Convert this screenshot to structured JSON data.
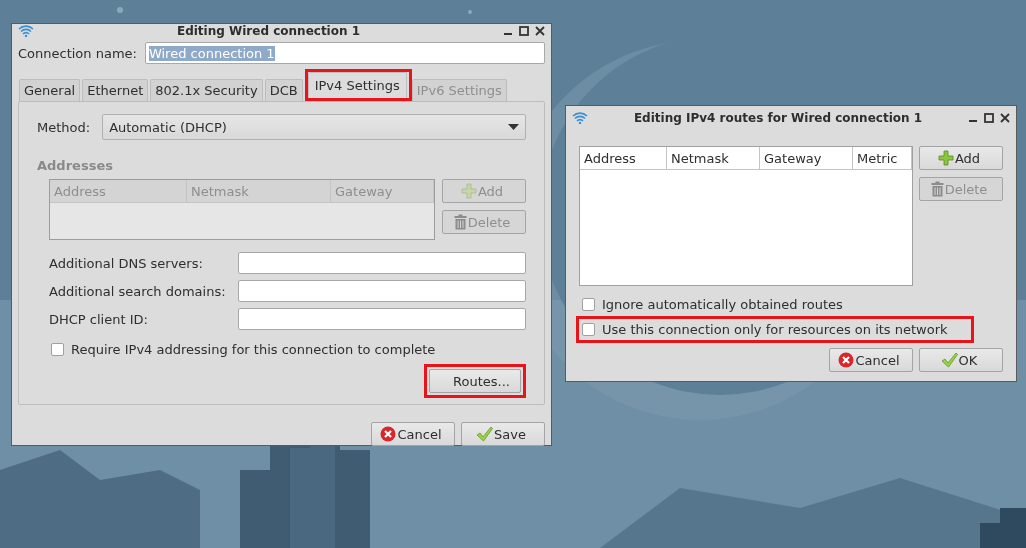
{
  "main_window": {
    "title": "Editing Wired connection 1",
    "connection_name": {
      "label": "Connection name:",
      "value": "Wired connection 1"
    },
    "tabs": [
      {
        "label": "General",
        "selected": false,
        "disabled": false,
        "highlighted": false
      },
      {
        "label": "Ethernet",
        "selected": false,
        "disabled": false,
        "highlighted": false
      },
      {
        "label": "802.1x Security",
        "selected": false,
        "disabled": false,
        "highlighted": false
      },
      {
        "label": "DCB",
        "selected": false,
        "disabled": false,
        "highlighted": false
      },
      {
        "label": "IPv4 Settings",
        "selected": true,
        "disabled": false,
        "highlighted": true
      },
      {
        "label": "IPv6 Settings",
        "selected": false,
        "disabled": true,
        "highlighted": false
      }
    ],
    "method": {
      "label": "Method:",
      "value": "Automatic (DHCP)"
    },
    "addresses": {
      "heading": "Addresses",
      "columns": [
        "Address",
        "Netmask",
        "Gateway"
      ],
      "buttons": [
        {
          "label": "Add",
          "kind": "add",
          "disabled": true
        },
        {
          "label": "Delete",
          "kind": "delete",
          "disabled": true
        }
      ]
    },
    "fields": [
      {
        "label": "Additional DNS servers:"
      },
      {
        "label": "Additional search domains:"
      },
      {
        "label": "DHCP client ID:"
      }
    ],
    "require_checkbox": {
      "label": "Require IPv4 addressing for this connection to complete",
      "checked": false,
      "highlighted": false
    },
    "routes_button": {
      "label": "Routes...",
      "kind": "plain",
      "disabled": false,
      "highlighted": true
    },
    "buttons": [
      {
        "label": "Cancel",
        "kind": "cancel",
        "disabled": false
      },
      {
        "label": "Save",
        "kind": "ok",
        "disabled": false
      }
    ]
  },
  "routes_window": {
    "title": "Editing IPv4 routes for Wired connection 1",
    "columns": [
      "Address",
      "Netmask",
      "Gateway",
      "Metric"
    ],
    "side_buttons": [
      {
        "label": "Add",
        "kind": "add",
        "disabled": false
      },
      {
        "label": "Delete",
        "kind": "delete",
        "disabled": true
      }
    ],
    "checkboxes": [
      {
        "label": "Ignore automatically obtained routes",
        "checked": false,
        "highlighted": false
      },
      {
        "label": "Use this connection only for resources on its network",
        "checked": false,
        "highlighted": true
      }
    ],
    "buttons": [
      {
        "label": "Cancel",
        "kind": "cancel",
        "disabled": false
      },
      {
        "label": "OK",
        "kind": "ok",
        "disabled": false
      }
    ]
  }
}
